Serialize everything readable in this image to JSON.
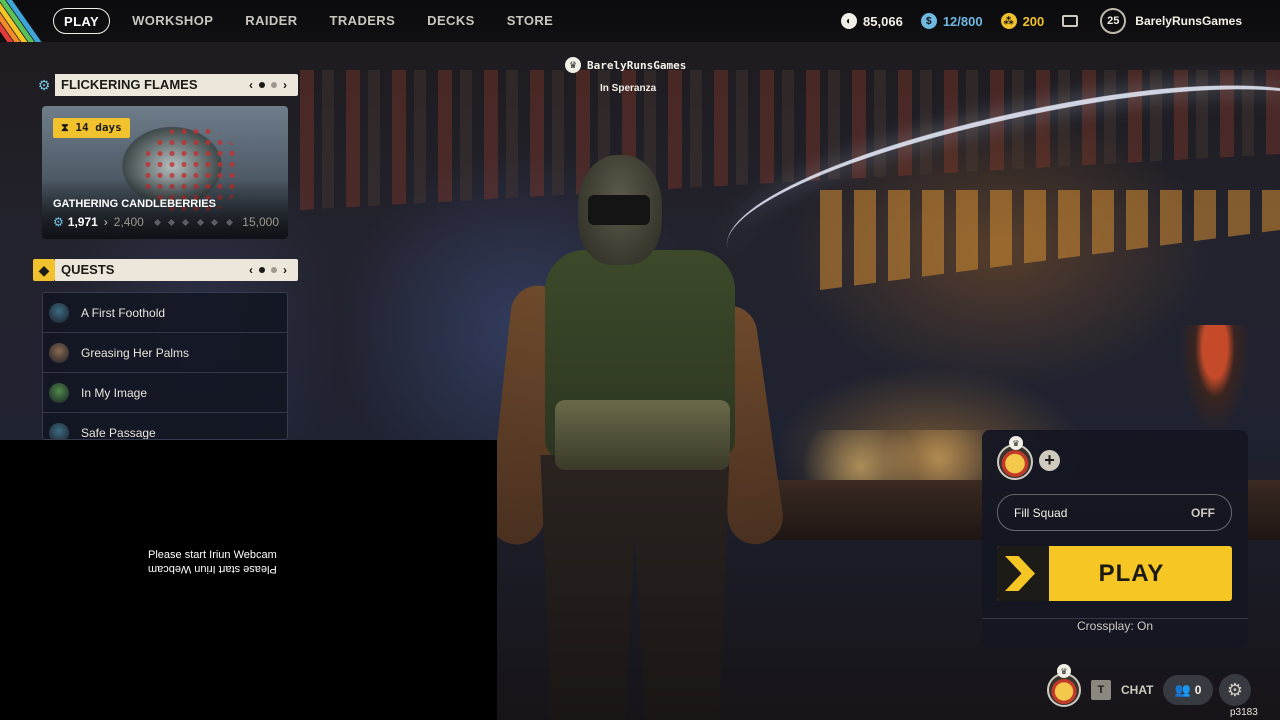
{
  "nav": {
    "items": [
      {
        "label": "PLAY",
        "active": true
      },
      {
        "label": "WORKSHOP",
        "active": false
      },
      {
        "label": "RAIDER",
        "active": false
      },
      {
        "label": "TRADERS",
        "active": false
      },
      {
        "label": "DECKS",
        "active": false
      },
      {
        "label": "STORE",
        "active": false
      }
    ],
    "stripe_colors": [
      "#e23b3b",
      "#f28c2a",
      "#f6c624",
      "#5bbf5a",
      "#3fa5d8"
    ]
  },
  "currencies": {
    "coins": {
      "value": "85,066",
      "icon": "coins-icon",
      "color": "#f2efe6"
    },
    "cred": {
      "value": "12/800",
      "icon": "cred-icon",
      "color": "#6fb8e0"
    },
    "tokens": {
      "value": "200",
      "icon": "raider-token-icon",
      "color": "#f2c12e"
    }
  },
  "profile": {
    "level": "25",
    "username": "BarelyRunsGames"
  },
  "player_tag": {
    "name": "BarelyRunsGames",
    "location": "In Speranza"
  },
  "event_panel": {
    "title": "FLICKERING FLAMES",
    "timer": "14 days",
    "event_name": "GATHERING CANDLEBERRIES",
    "progress_current": "1,971",
    "progress_next": "2,400",
    "progress_max": "15,000"
  },
  "quests_panel": {
    "title": "QUESTS",
    "items": [
      {
        "label": "A First Foothold",
        "avatar_color": "#3d6b82"
      },
      {
        "label": "Greasing Her Palms",
        "avatar_color": "#8a6a52"
      },
      {
        "label": "In My Image",
        "avatar_color": "#4f8a4a"
      },
      {
        "label": "Safe Passage",
        "avatar_color": "#3d6b82"
      }
    ]
  },
  "webcam": {
    "message": "Please start Iriun Webcam"
  },
  "squad": {
    "fill_squad_label": "Fill Squad",
    "fill_squad_state": "OFF",
    "play_label": "PLAY",
    "crossplay": "Crossplay: On",
    "accent": "#f6c624"
  },
  "bottom_bar": {
    "chat_key": "T",
    "chat_label": "CHAT",
    "friends_count": "0",
    "build_id": "p3183"
  }
}
